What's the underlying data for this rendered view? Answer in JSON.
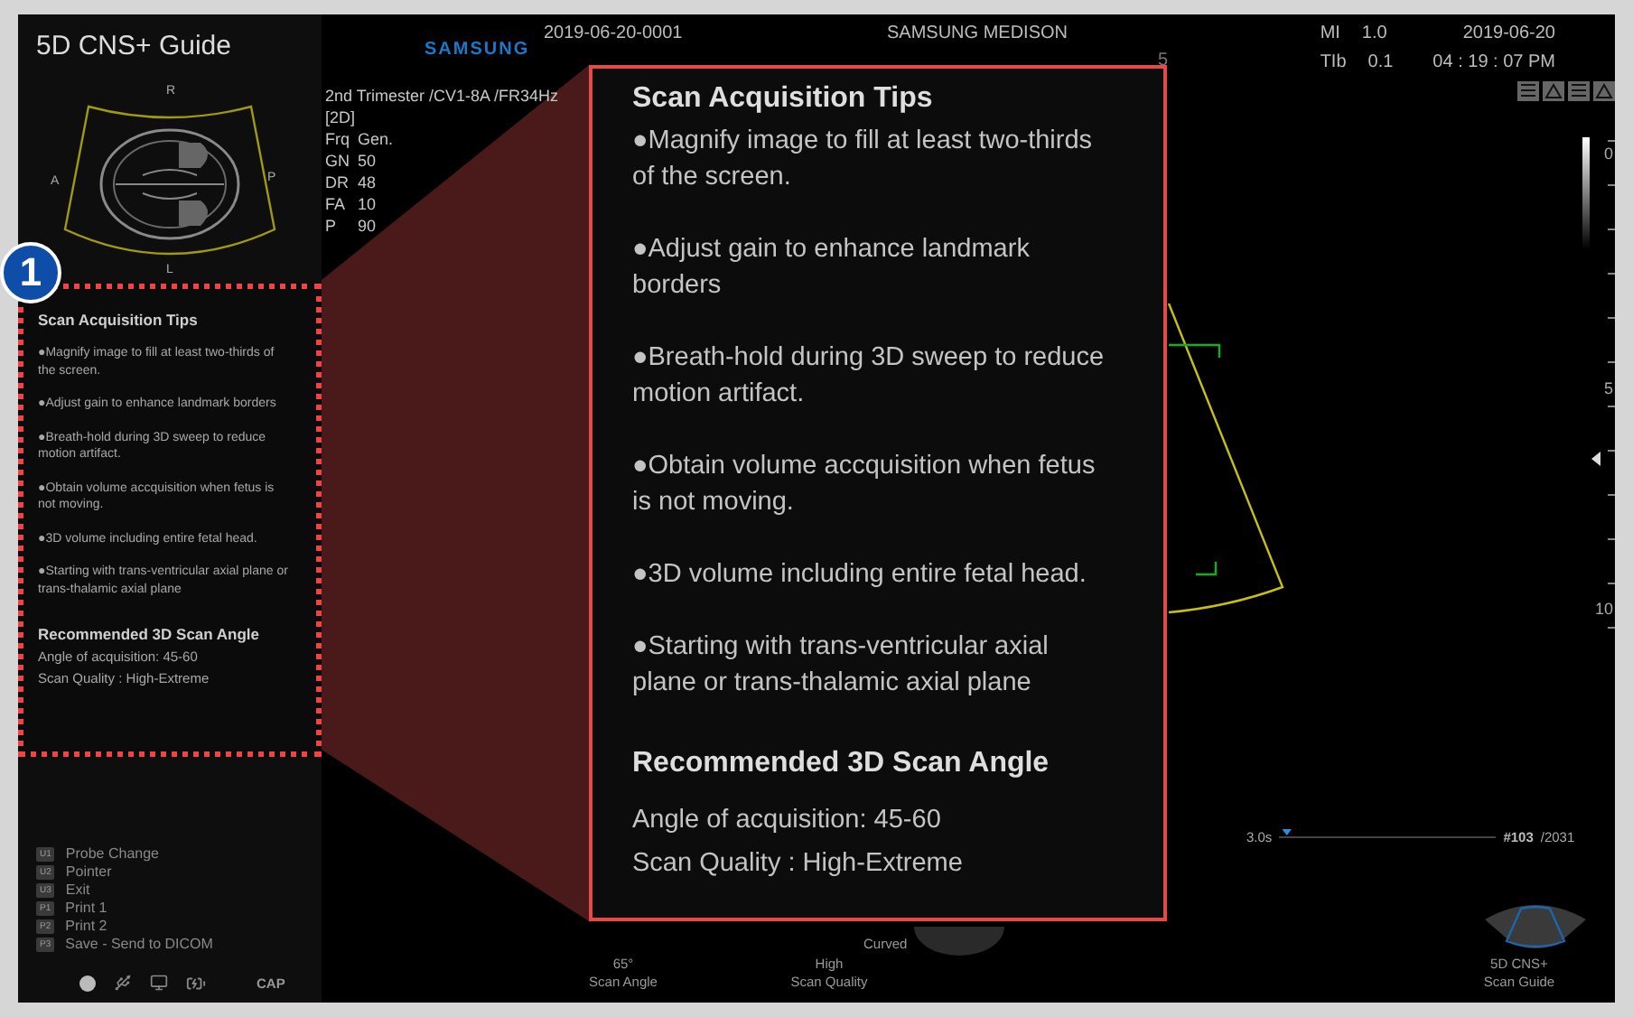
{
  "app_title": "5D CNS+ Guide",
  "diagram_labels": {
    "top": "R",
    "left": "A",
    "right": "P",
    "bottom": "L"
  },
  "callout_badge": "1",
  "tips": {
    "title": "Scan Acquisition Tips",
    "items": [
      "●Magnify image to fill at least two-thirds of the screen.",
      "●Adjust gain to enhance landmark borders",
      "●Breath-hold during 3D sweep to reduce motion artifact.",
      "●Obtain volume accquisition when fetus is not moving.",
      "●3D volume including entire fetal head.",
      "●Starting with trans-ventricular axial plane or trans-thalamic axial plane"
    ],
    "angle_title": "Recommended 3D Scan Angle",
    "angle_lines": [
      "Angle of acquisition: 45-60",
      "Scan Quality : High-Extreme"
    ]
  },
  "callout": {
    "title": "Scan Acquisition Tips",
    "items": [
      "●Magnify image to fill at least two-thirds of the screen.",
      "●Adjust gain to enhance landmark borders",
      "●Breath-hold during 3D sweep to reduce motion artifact.",
      "●Obtain volume accquisition when fetus is not moving.",
      "●3D volume including entire fetal head.",
      "●Starting with trans-ventricular axial plane or trans-thalamic axial plane"
    ],
    "angle_title": "Recommended 3D Scan Angle",
    "angle_lines": [
      "Angle of acquisition: 45-60",
      "Scan Quality : High-Extreme"
    ]
  },
  "shortcuts": [
    {
      "key": "U1",
      "label": "Probe Change"
    },
    {
      "key": "U2",
      "label": "Pointer"
    },
    {
      "key": "U3",
      "label": "Exit"
    },
    {
      "key": "P1",
      "label": "Print 1"
    },
    {
      "key": "P2",
      "label": "Print 2"
    },
    {
      "key": "P3",
      "label": "Save - Send to DICOM"
    }
  ],
  "cap": "CAP",
  "header": {
    "brand": "SAMSUNG",
    "patient_id": "2019-06-20-0001",
    "institution": "SAMSUNG MEDISON",
    "depth_marker": "5",
    "mi_label": "MI",
    "mi": "1.0",
    "tib_label": "TIb",
    "tib": "0.1",
    "date": "2019-06-20",
    "time": "04 : 19 : 07 PM"
  },
  "preset": "2nd Trimester /CV1-8A /FR34Hz",
  "mode": "[2D]",
  "params": [
    {
      "name": "Frq",
      "value": "Gen."
    },
    {
      "name": "GN",
      "value": "50"
    },
    {
      "name": "DR",
      "value": "48"
    },
    {
      "name": "FA",
      "value": "10"
    },
    {
      "name": "P",
      "value": "90"
    }
  ],
  "scale": [
    "0",
    "5",
    "10"
  ],
  "cine": {
    "time": "3.0s",
    "frame": "#103",
    "total": "/2031",
    "level": 0.01
  },
  "probe_label": "Curved",
  "bottom_controls": [
    {
      "value": "65°",
      "label": "Scan Angle"
    },
    {
      "value": "High",
      "label": "Scan Quality"
    },
    {
      "value": "5D CNS+",
      "label": "Scan Guide"
    }
  ]
}
